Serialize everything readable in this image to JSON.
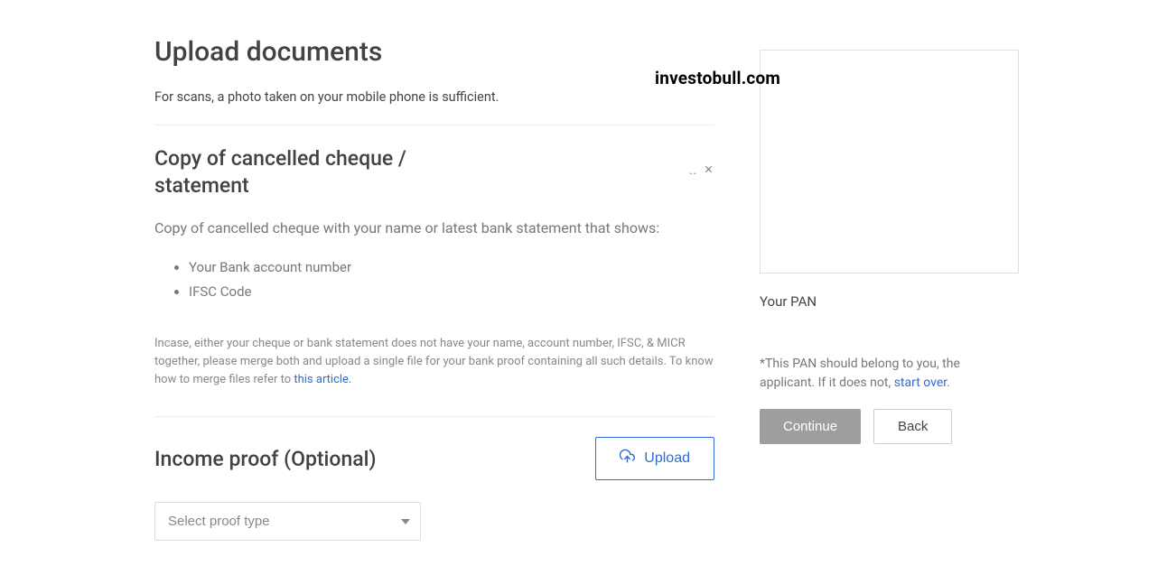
{
  "watermark": "investobull.com",
  "page": {
    "title": "Upload documents",
    "subtitle": "For scans, a photo taken on your mobile phone is sufficient."
  },
  "cheque": {
    "title": "Copy of cancelled cheque / statement",
    "file_dots": "..",
    "desc": "Copy of cancelled cheque with your name or latest bank statement that shows:",
    "reqs": [
      "Your Bank account number",
      "IFSC Code"
    ],
    "fine1": "Incase, either your cheque or bank statement does not have your name, account number, IFSC, & MICR together, please merge both and upload a single file for your bank proof containing all such details. To know how to merge files refer to ",
    "fine_link": "this article."
  },
  "income": {
    "title": "Income proof (Optional)",
    "upload_label": "Upload",
    "select_placeholder": "Select proof type"
  },
  "pan": {
    "label": "Your PAN",
    "note_prefix": "*This PAN should belong to you, the applicant. If it does not, ",
    "note_link": "start over",
    "note_suffix": ".",
    "continue_label": "Continue",
    "back_label": "Back"
  }
}
